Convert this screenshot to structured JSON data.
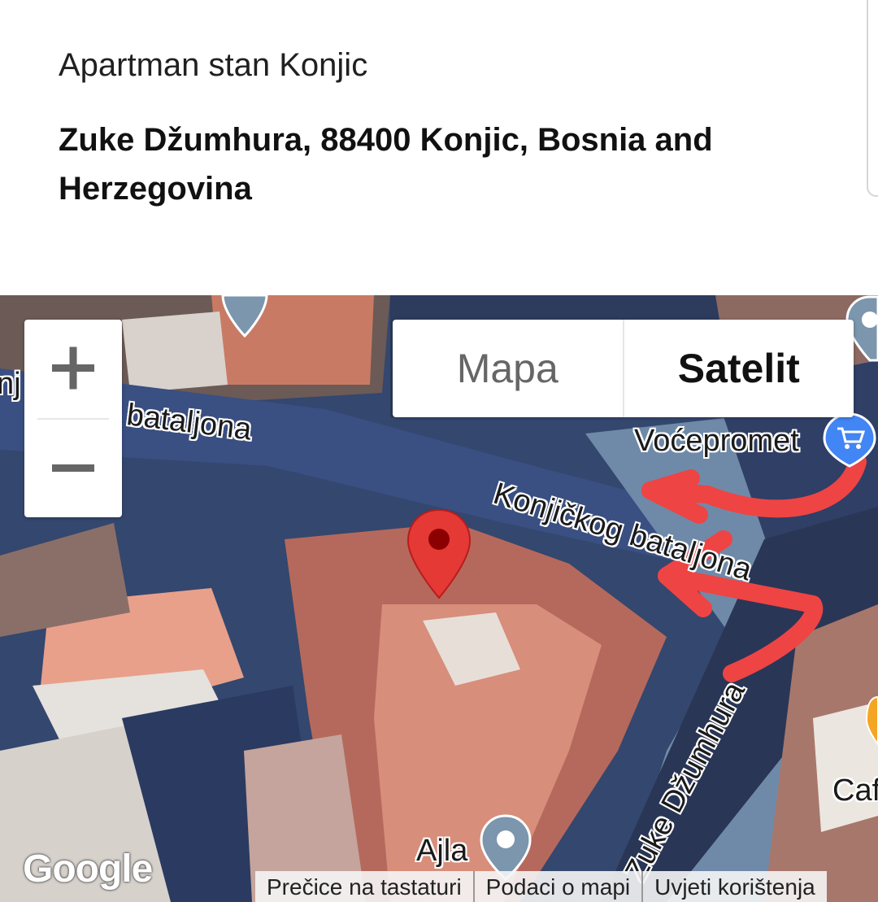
{
  "listing": {
    "name": "Apartman stan Konjic",
    "address": "Zuke Džumhura, 88400 Konjic, Bosnia and Herzegovina"
  },
  "map": {
    "view_type": "satellite",
    "zoom_in_label": "+",
    "zoom_out_label": "−",
    "type_options": {
      "map": "Mapa",
      "satellite": "Satelit"
    },
    "street_labels": {
      "bataljona_left": "bataljona",
      "konjickog_bataljona": "Konjičkog bataljona",
      "zuke_dzumhura": "Zuke Džumhura",
      "edge_left": "nj"
    },
    "place_labels": {
      "vocepromet": "Voćepromet",
      "ajla": "Ajla",
      "cafe": "Caf"
    },
    "logo": "Google",
    "footer_links": [
      "Prečice na tastaturi",
      "Podaci o mapi",
      "Uvjeti korištenja"
    ],
    "colors": {
      "marker": "#e53935",
      "annotation_arrows": "#ef4444",
      "shopping_pin": "#4285f4",
      "poi_pin": "#7b96ad",
      "orange_pin": "#f4a623"
    }
  }
}
